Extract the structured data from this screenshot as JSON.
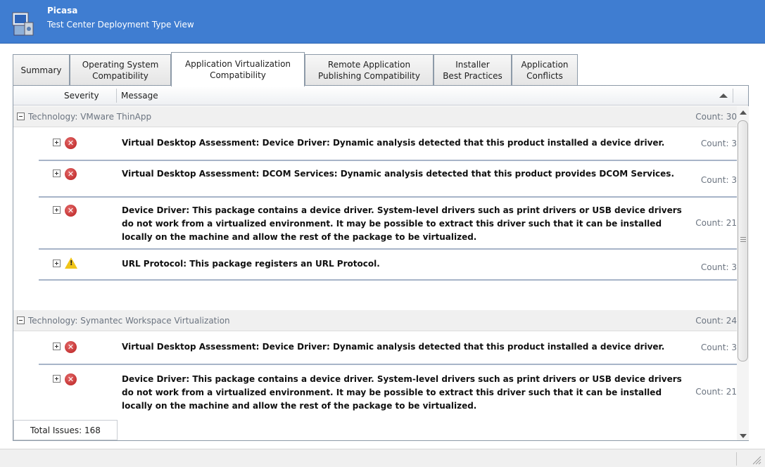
{
  "window": {
    "title": "Picasa",
    "subtitle": "Test Center Deployment Type View"
  },
  "tabs": [
    {
      "label": "Summary",
      "active": false
    },
    {
      "label": "Operating System\nCompatibility",
      "active": false
    },
    {
      "label": "Application Virtualization\nCompatibility",
      "active": true
    },
    {
      "label": "Remote Application\nPublishing Compatibility",
      "active": false
    },
    {
      "label": "Installer\nBest Practices",
      "active": false
    },
    {
      "label": "Application\nConflicts",
      "active": false
    }
  ],
  "columns": {
    "severity": "Severity",
    "message": "Message"
  },
  "groups": [
    {
      "label": "Technology: VMware ThinApp",
      "count": "Count: 30"
    },
    {
      "label": "Technology: Symantec Workspace Virtualization",
      "count": "Count: 24"
    }
  ],
  "issues": [
    {
      "severity": "error",
      "message": "Virtual Desktop Assessment: Device Driver: Dynamic analysis detected that this product installed a device driver.",
      "count": "Count: 3"
    },
    {
      "severity": "error",
      "message": "Virtual Desktop Assessment: DCOM Services: Dynamic analysis detected that this product provides DCOM Services.",
      "count": "Count: 3"
    },
    {
      "severity": "error",
      "message": "Device Driver: This package contains a device driver. System-level drivers such as print drivers or USB device drivers do not work from a virtualized environment. It may be possible to extract this driver such that it can be installed locally on the machine and allow the rest of the package to be virtualized.",
      "count": "Count: 21"
    },
    {
      "severity": "warning",
      "message": "URL Protocol: This package registers an URL Protocol.",
      "count": "Count: 3"
    },
    {
      "severity": "error",
      "message": "Virtual Desktop Assessment: Device Driver: Dynamic analysis detected that this product installed a device driver.",
      "count": "Count: 3"
    },
    {
      "severity": "error",
      "message": "Device Driver: This package contains a device driver. System-level drivers such as print drivers or USB device drivers do not work from a virtualized environment. It may be possible to extract this driver such that it can be installed locally on the machine and allow the rest of the package to be virtualized.",
      "count": "Count: 21"
    }
  ],
  "footer": {
    "total": "Total Issues: 168"
  },
  "colors": {
    "titlebar": "#3f7dd1",
    "error": "#c0282d",
    "warning": "#f0c419"
  }
}
